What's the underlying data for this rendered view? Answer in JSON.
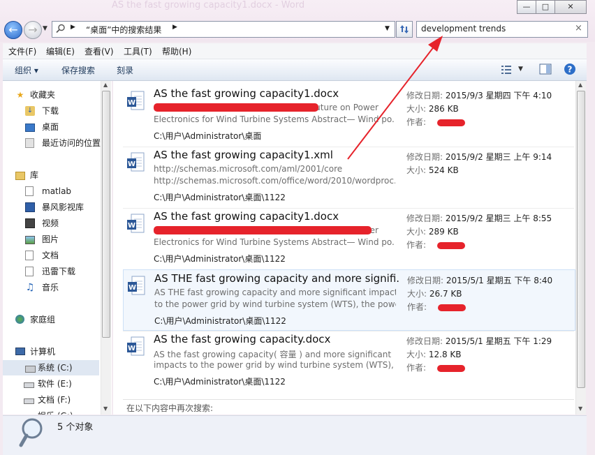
{
  "window": {
    "faded_title": "AS the fast growing capacity1.docx - Word",
    "controls": [
      "—",
      "□",
      "✕"
    ]
  },
  "nav": {
    "address_text": "“桌面”中的搜索结果",
    "search_value": "development trends"
  },
  "menubar": [
    "文件(F)",
    "编辑(E)",
    "查看(V)",
    "工具(T)",
    "帮助(H)"
  ],
  "toolbar": {
    "organize": "组织 ▾",
    "save_search": "保存搜索",
    "burn": "刻录"
  },
  "sidebar": {
    "favorites": {
      "label": "收藏夹",
      "items": [
        "下载",
        "桌面",
        "最近访问的位置"
      ]
    },
    "libraries": {
      "label": "库",
      "items": [
        "matlab",
        "暴风影视库",
        "视频",
        "图片",
        "文档",
        "迅雷下载",
        "音乐"
      ]
    },
    "homegroup": "家庭组",
    "computer": {
      "label": "计算机",
      "items": [
        "系统 (C:)",
        "软件 (E:)",
        "文档 (F:)",
        "娱乐 (G:)"
      ]
    }
  },
  "meta_labels": {
    "modified": "修改日期:",
    "size": "大小:",
    "author": "作者:"
  },
  "results": [
    {
      "title": "AS the fast growing capacity1.docx",
      "snippet1": "Future on Power",
      "snippet2": "Electronics for Wind Turbine Systems Abstract— Wind po...",
      "path": "C:\\用户\\Administrator\\桌面",
      "modified": "2015/9/3 星期四 下午 4:10",
      "size": "286 KB"
    },
    {
      "title": "AS the fast growing capacity1.xml",
      "snippet1": "http://schemas.microsoft.com/aml/2001/core",
      "snippet2": "http://schemas.microsoft.com/office/word/2010/wordproc...",
      "path": "C:\\用户\\Administrator\\桌面\\1122",
      "modified": "2015/9/2 星期三 上午 9:14",
      "size": "524 KB"
    },
    {
      "title": "AS the fast growing capacity1.docx",
      "snippet1": "er",
      "snippet2": "Electronics for Wind Turbine Systems Abstract— Wind po...",
      "path": "C:\\用户\\Administrator\\桌面\\1122",
      "modified": "2015/9/2 星期三 上午 8:55",
      "size": "289 KB"
    },
    {
      "title": "AS THE fast growing capacity and more signifi...",
      "snippet1": "AS THE fast growing capacity and more significant impacts",
      "snippet2": "to the power grid by wind turbine system (WTS), the powe...",
      "path": "C:\\用户\\Administrator\\桌面\\1122",
      "modified": "2015/5/1 星期五 下午 8:40",
      "size": "26.7 KB"
    },
    {
      "title": "AS the fast growing capacity.docx",
      "snippet1": "AS the fast growing capacity( 容量 ) and more significant",
      "snippet2": "impacts to the power grid by wind turbine system (WTS), t...",
      "path": "C:\\用户\\Administrator\\桌面\\1122",
      "modified": "2015/5/1 星期五 下午 1:29",
      "size": "12.8 KB"
    }
  ],
  "search_again": "在以下内容中再次搜索:",
  "status": {
    "count": "5 个对象"
  },
  "colors": {
    "annotation_red": "#e6232b",
    "word_blue": "#2b5797"
  }
}
